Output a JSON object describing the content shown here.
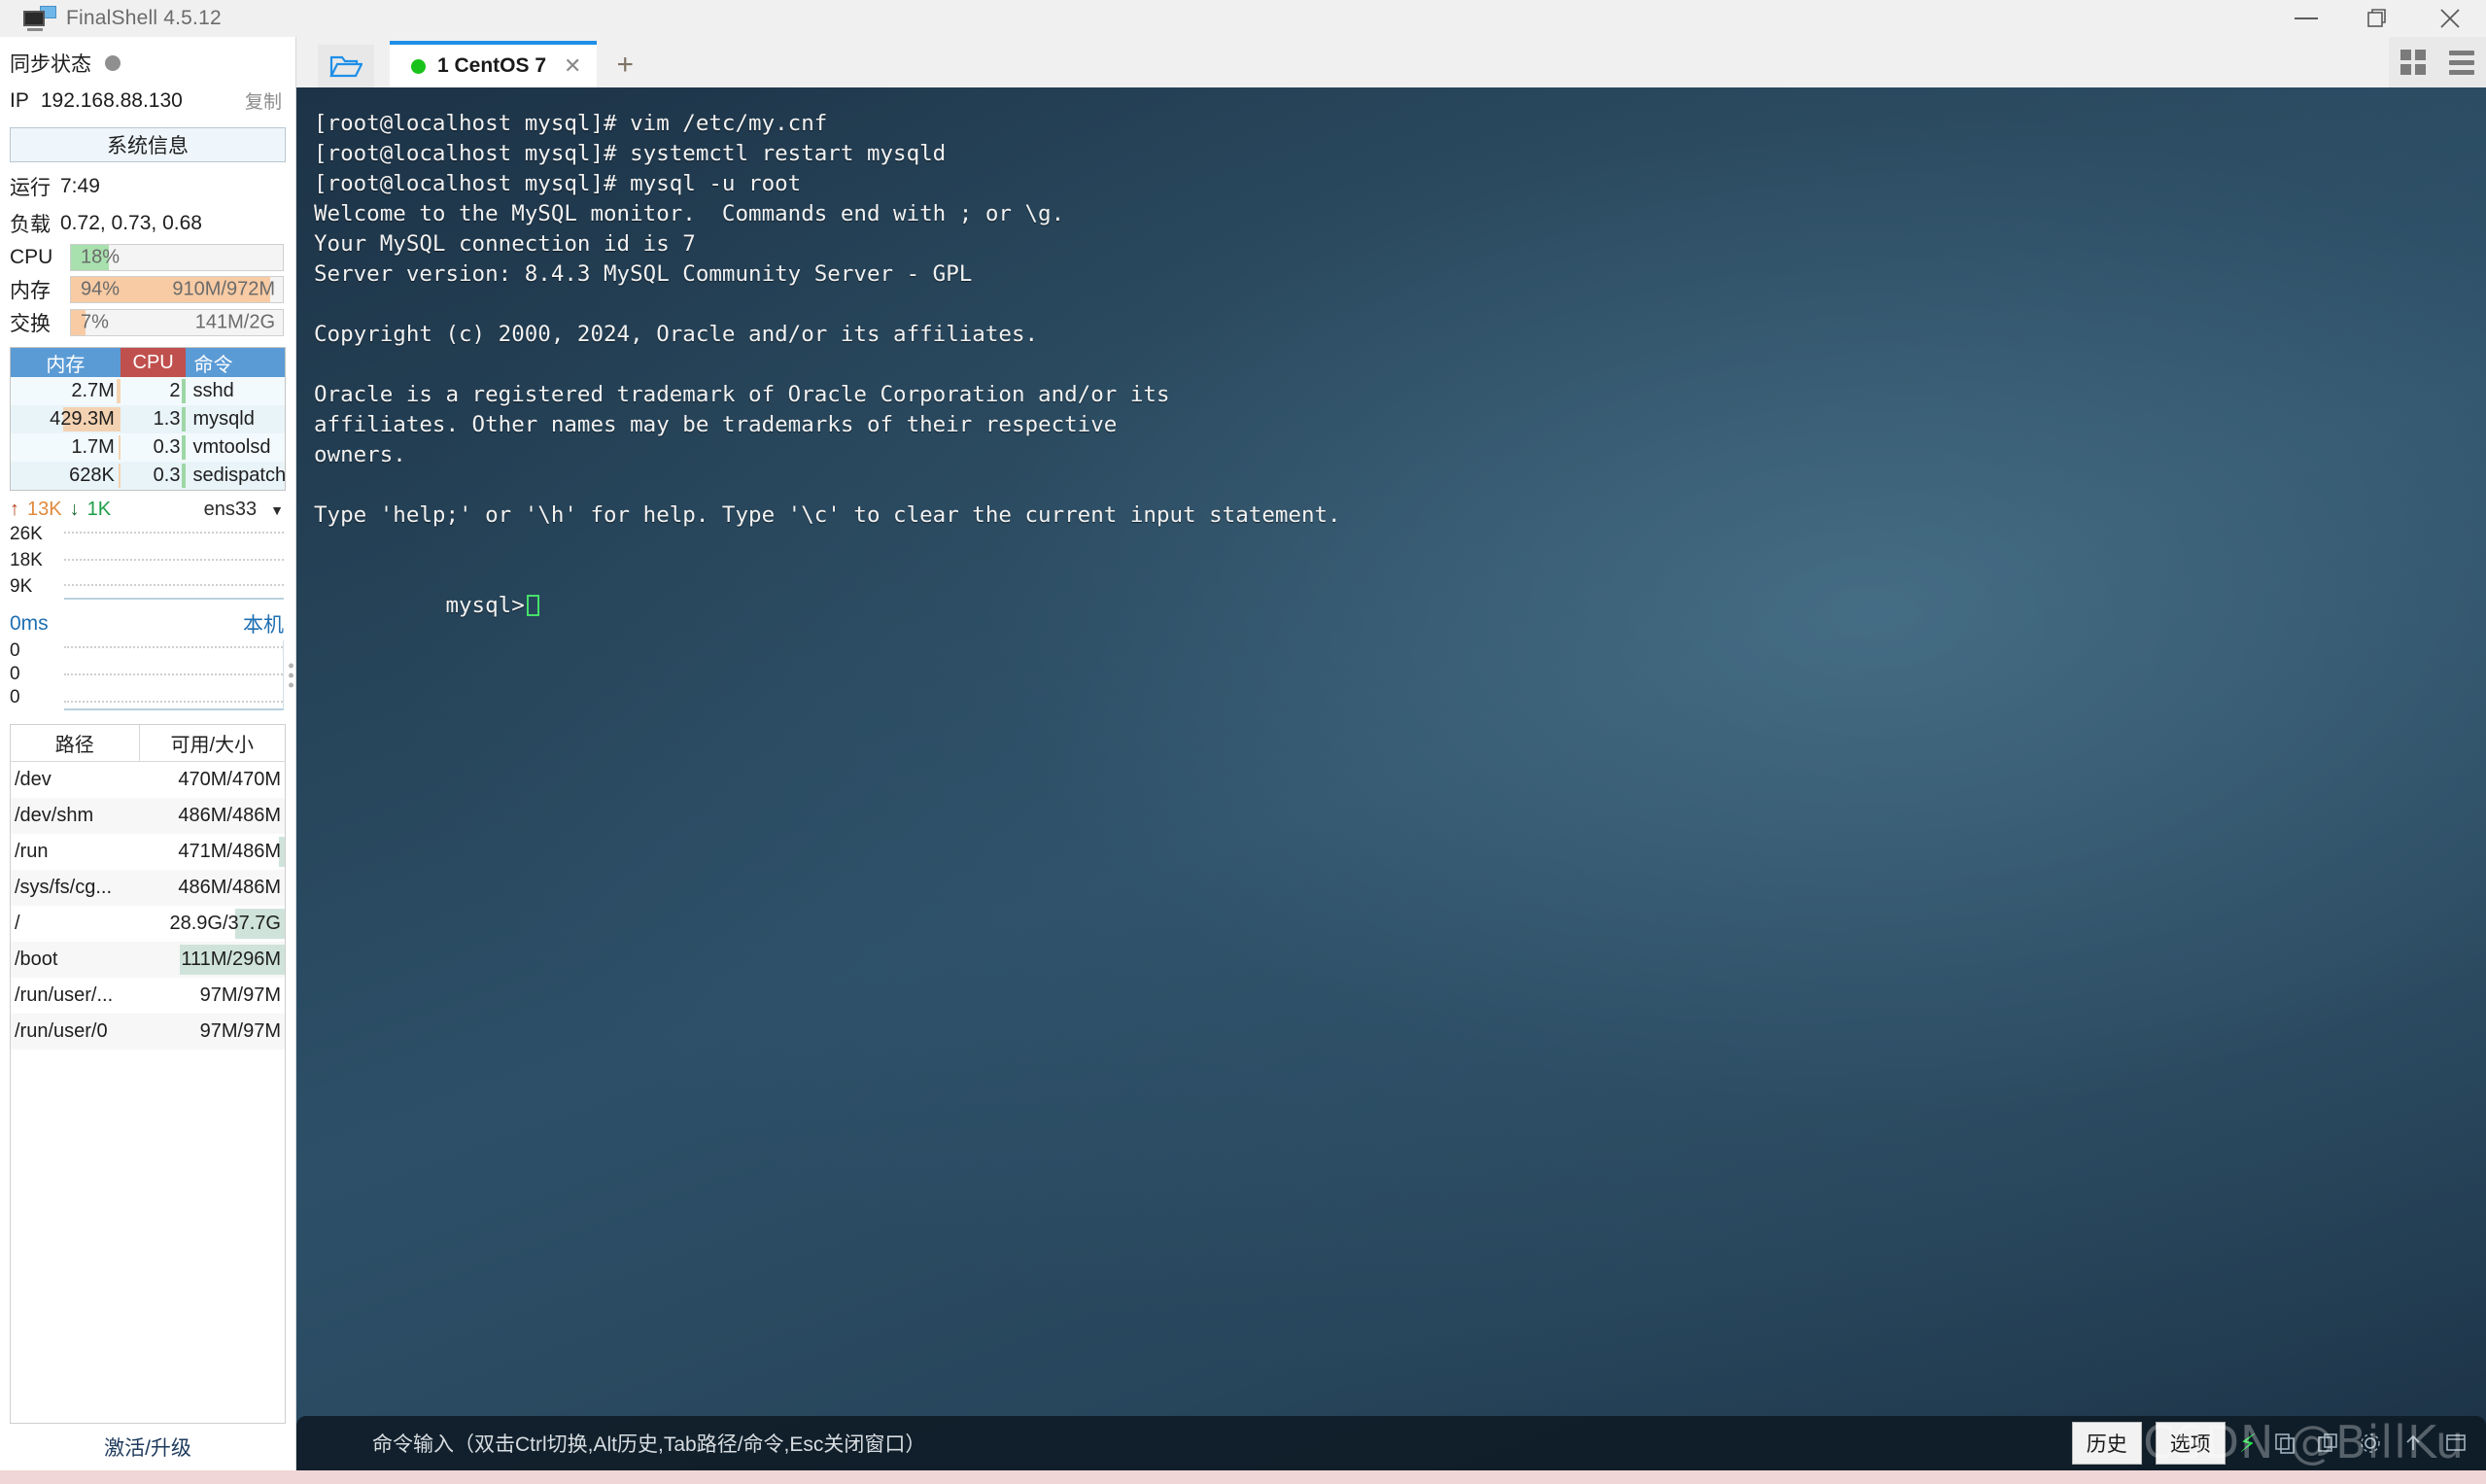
{
  "window": {
    "title": "FinalShell 4.5.12",
    "icon": "monitor-icon",
    "minimize": "—",
    "maximize": "restore-icon",
    "close": "✕"
  },
  "sidebar": {
    "sync_label": "同步状态",
    "ip_key": "IP",
    "ip_value": "192.168.88.130",
    "copy_label": "复制",
    "sysinfo_button": "系统信息",
    "uptime_key": "运行",
    "uptime_value": "7:49",
    "load_key": "负载",
    "load_value": "0.72, 0.73, 0.68",
    "meters": [
      {
        "name": "CPU",
        "percent": "18%",
        "detail": "",
        "fill": 18,
        "color": "#a8e0ae"
      },
      {
        "name": "内存",
        "percent": "94%",
        "detail": "910M/972M",
        "fill": 94,
        "color": "#f8cba4"
      },
      {
        "name": "交换",
        "percent": "7%",
        "detail": "141M/2G",
        "fill": 7,
        "color": "#f8cba4"
      }
    ],
    "processes": {
      "headers": {
        "mem": "内存",
        "cpu": "CPU",
        "cmd": "命令"
      },
      "rows": [
        {
          "mem": "2.7M",
          "cpu": "2",
          "cmd": "sshd",
          "mem_bar": 3,
          "cpu_bar": 6
        },
        {
          "mem": "429.3M",
          "cpu": "1.3",
          "cmd": "mysqld",
          "mem_bar": 52,
          "cpu_bar": 5
        },
        {
          "mem": "1.7M",
          "cpu": "0.3",
          "cmd": "vmtoolsd",
          "mem_bar": 2,
          "cpu_bar": 4
        },
        {
          "mem": "628K",
          "cpu": "0.3",
          "cmd": "sedispatch",
          "mem_bar": 2,
          "cpu_bar": 4
        }
      ]
    },
    "network": {
      "up_arrow": "↑",
      "up_value": "13K",
      "down_arrow": "↓",
      "down_value": "1K",
      "interface": "ens33",
      "caret": "▼",
      "y_labels": [
        "26K",
        "18K",
        "9K"
      ]
    },
    "latency": {
      "value": "0ms",
      "host_label": "本机",
      "y_labels": [
        "0",
        "0",
        "0"
      ]
    },
    "disks": {
      "headers": {
        "path": "路径",
        "size": "可用/大小"
      },
      "rows": [
        {
          "path": "/dev",
          "size": "470M/470M",
          "hl": 0
        },
        {
          "path": "/dev/shm",
          "size": "486M/486M",
          "hl": 0
        },
        {
          "path": "/run",
          "size": "471M/486M",
          "hl": 4
        },
        {
          "path": "/sys/fs/cg...",
          "size": "486M/486M",
          "hl": 0
        },
        {
          "path": "/",
          "size": "28.9G/37.7G",
          "hl": 34
        },
        {
          "path": "/boot",
          "size": "111M/296M",
          "hl": 72
        },
        {
          "path": "/run/user/...",
          "size": "97M/97M",
          "hl": 0
        },
        {
          "path": "/run/user/0",
          "size": "97M/97M",
          "hl": 0
        }
      ]
    },
    "activate_label": "激活/升级"
  },
  "tabbar": {
    "folder_icon": "folder-icon",
    "tabs": [
      {
        "status_dot": "green",
        "label": "1 CentOS 7",
        "close": "✕"
      }
    ],
    "add_label": "+",
    "grid_icon": "grid-view-icon",
    "menu_icon": "hamburger-menu-icon"
  },
  "terminal": {
    "lines": [
      "[root@localhost mysql]# vim /etc/my.cnf",
      "[root@localhost mysql]# systemctl restart mysqld",
      "[root@localhost mysql]# mysql -u root",
      "Welcome to the MySQL monitor.  Commands end with ; or \\g.",
      "Your MySQL connection id is 7",
      "Server version: 8.4.3 MySQL Community Server - GPL",
      "",
      "Copyright (c) 2000, 2024, Oracle and/or its affiliates.",
      "",
      "Oracle is a registered trademark of Oracle Corporation and/or its",
      "affiliates. Other names may be trademarks of their respective",
      "owners.",
      "",
      "Type 'help;' or '\\h' for help. Type '\\c' to clear the current input statement.",
      ""
    ],
    "prompt": "mysql>"
  },
  "cmdbar": {
    "placeholder": "命令输入（双击Ctrl切换,Alt历史,Tab路径/命令,Esc关闭窗口）",
    "history_button": "历史",
    "options_button": "选项",
    "bolt_icon": "lightning-icon",
    "icons": [
      "copy-icon",
      "paste-icon",
      "gear-icon",
      "upload-icon",
      "window-icon"
    ]
  },
  "watermark": "CSDN @BillKu"
}
